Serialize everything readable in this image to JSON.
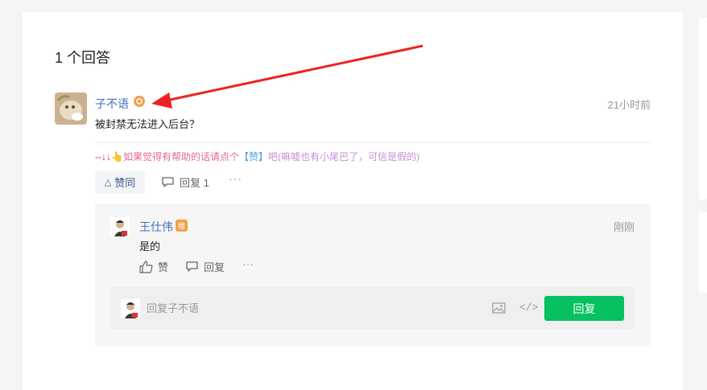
{
  "answers": {
    "title": "1 个回答"
  },
  "answer": {
    "author": "子不语",
    "time": "21小时前",
    "content": "被封禁无法进入后台？",
    "signature": {
      "arrow": "--↓↓",
      "text1": "👆如果觉得有帮助的话请点个",
      "like": "【赞】",
      "text2": "吧(嘛嘘也有小尾巴了，可信是假的)"
    },
    "like_label": "赞同",
    "reply_label": "回复 1",
    "more_label": "···"
  },
  "reply": {
    "author": "王仕伟",
    "badge": "楼",
    "time": "刚刚",
    "content": "是的",
    "like_label": "赞",
    "reply_label": "回复",
    "more_label": "···"
  },
  "compose": {
    "placeholder": "回复子不语",
    "submit_label": "回复",
    "code_icon_text": "</>"
  },
  "colors": {
    "accent": "#07c160",
    "name": "#3d6fbf",
    "arrow": "#ee2222"
  },
  "icons": [
    "medal-icon",
    "thumb-up-icon",
    "comment-icon",
    "image-icon",
    "code-icon",
    "more-icon"
  ]
}
